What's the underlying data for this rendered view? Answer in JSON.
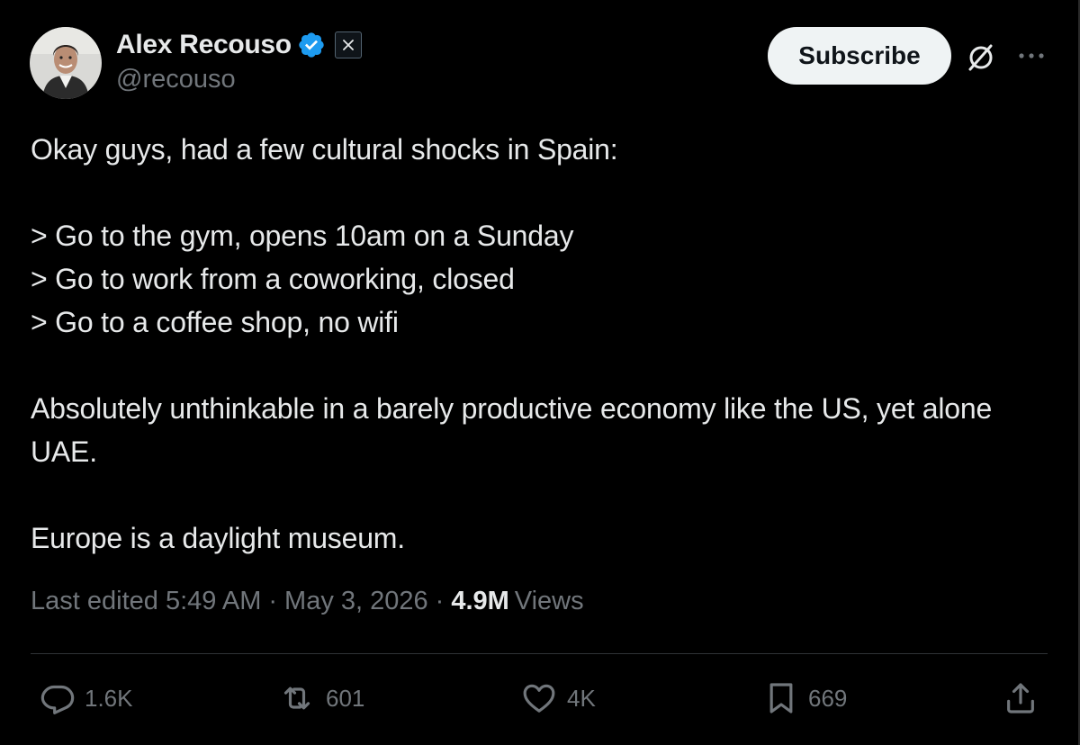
{
  "author": {
    "display_name": "Alex Recouso",
    "handle": "@recouso",
    "verified": true,
    "affiliate_badge_icon": "x-logo-icon",
    "verified_color": "#1d9bf0"
  },
  "header": {
    "subscribe_label": "Subscribe",
    "grok_icon": "grok-icon",
    "more_icon": "more-icon"
  },
  "tweet": {
    "line_1": "Okay guys, had a few cultural shocks in Spain:",
    "line_2": "> Go to the gym, opens 10am on a Sunday",
    "line_3": "> Go to work from a coworking, closed",
    "line_4": "> Go to a coffee shop, no wifi",
    "line_5": "Absolutely unthinkable in a barely productive economy like the US, yet alone UAE.",
    "line_6": "Europe is a daylight museum."
  },
  "meta": {
    "edited_label": "Last edited",
    "time": "5:49 AM",
    "separator": "·",
    "date": "May 3, 2026",
    "views_count": "4.9M",
    "views_label": "Views"
  },
  "actions": {
    "reply_count": "1.6K",
    "retweet_count": "601",
    "like_count": "4K",
    "bookmark_count": "669"
  },
  "colors": {
    "background": "#000000",
    "text_primary": "#e7e9ea",
    "text_secondary": "#71767b",
    "divider": "#2f3336",
    "button_bg": "#eff3f4"
  }
}
